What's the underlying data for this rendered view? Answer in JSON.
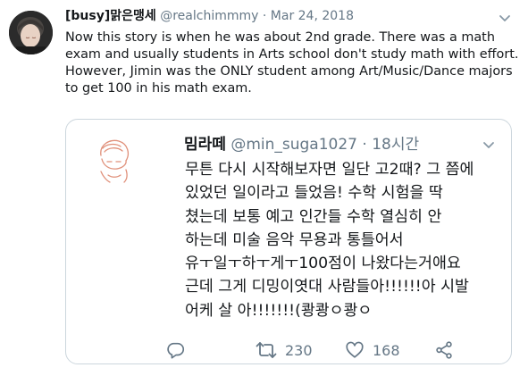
{
  "tweet": {
    "name": "[busy]맑은맹세",
    "handle": "@realchimmmy",
    "separator": "·",
    "date": "Mar 24, 2018",
    "text": "Now this story is when he was about 2nd grade. There was a math\nexam and usually students in Arts school don't study math with effort.\nHowever, Jimin was the ONLY student among Art/Music/Dance majors\nto get 100 in his math exam."
  },
  "quote": {
    "name": "밈라떼",
    "handle": "@min_suga1027",
    "separator": "·",
    "time": "18시간",
    "text": "무튼 다시 시작해보자면 일단 고2때? 그 쯤에\n있었던 일이라고 들었음! 수학 시험을 딱\n쳤는데 보통 예고 인간들 수학 열심히 안\n하는데 미술 음악 무용과 통틀어서\n유ㅜ일ㅜ하ㅜ게ㅜ100점이 나왔다는거애요\n근데 그게 디밍이엿대 사람들아!!!!!!아 시발\n어케 살 아!!!!!!!(쾅쾅ㅇ쾅ㅇ",
    "retweet_count": "230",
    "like_count": "168"
  },
  "icons": {
    "caret": "chevron-down-icon",
    "reply": "reply-icon",
    "retweet": "retweet-icon",
    "like": "heart-icon",
    "share": "share-icon"
  },
  "colors": {
    "text": "#14171a",
    "muted": "#657786",
    "border": "#ccd6dd",
    "avatar_bg": "#2a2a2a",
    "sketch": "#e0907a"
  }
}
